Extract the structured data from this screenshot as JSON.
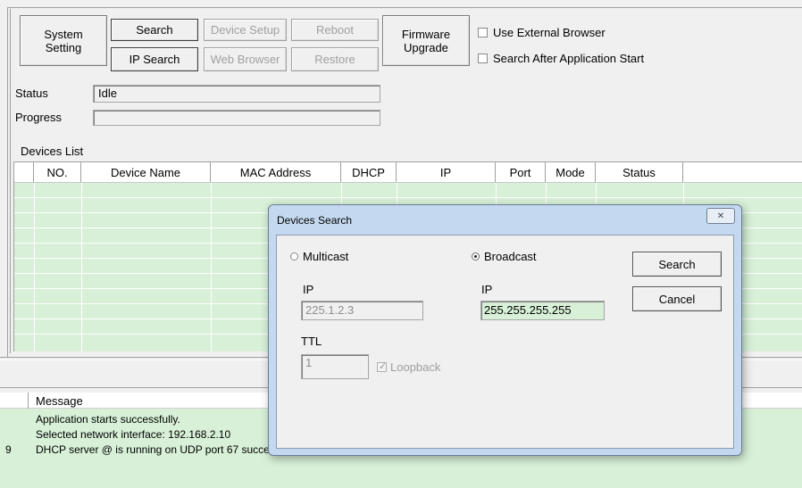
{
  "toolbar": {
    "system_setting": "System\nSetting",
    "search": "Search",
    "ip_search": "IP Search",
    "device_setup": "Device Setup",
    "web_browser": "Web Browser",
    "reboot": "Reboot",
    "restore": "Restore",
    "firmware_upgrade": "Firmware\nUpgrade",
    "use_external_browser": "Use External Browser",
    "search_after_start": "Search After Application Start"
  },
  "status": {
    "label": "Status",
    "value": "Idle"
  },
  "progress": {
    "label": "Progress",
    "value": 0
  },
  "devices_list": {
    "label": "Devices List",
    "columns": [
      "NO.",
      "Device Name",
      "MAC Address",
      "DHCP",
      "IP",
      "Port",
      "Mode",
      "Status"
    ]
  },
  "messages": {
    "header": "Message",
    "rows": [
      {
        "num": "",
        "text": "Application starts successfully."
      },
      {
        "num": "",
        "text": "Selected network interface: 192.168.2.10"
      },
      {
        "num": "9",
        "text": "DHCP server @  is running on UDP port 67 successfully."
      }
    ]
  },
  "dialog": {
    "title": "Devices Search",
    "close_glyph": "✕",
    "multicast_label": "Multicast",
    "broadcast_label": "Broadcast",
    "ip_label_left": "IP",
    "ip_value_left": "225.1.2.3",
    "ip_label_right": "IP",
    "ip_value_right": "255.255.255.255",
    "ttl_label": "TTL",
    "ttl_value": "1",
    "loopback_label": "Loopback",
    "search_button": "Search",
    "cancel_button": "Cancel",
    "selected_mode": "Broadcast",
    "loopback_checked": true
  },
  "colors": {
    "list_background": "#d7f0d7",
    "ip_field_background": "#d7f0d7",
    "dialog_frame": "#b9d1ea"
  }
}
